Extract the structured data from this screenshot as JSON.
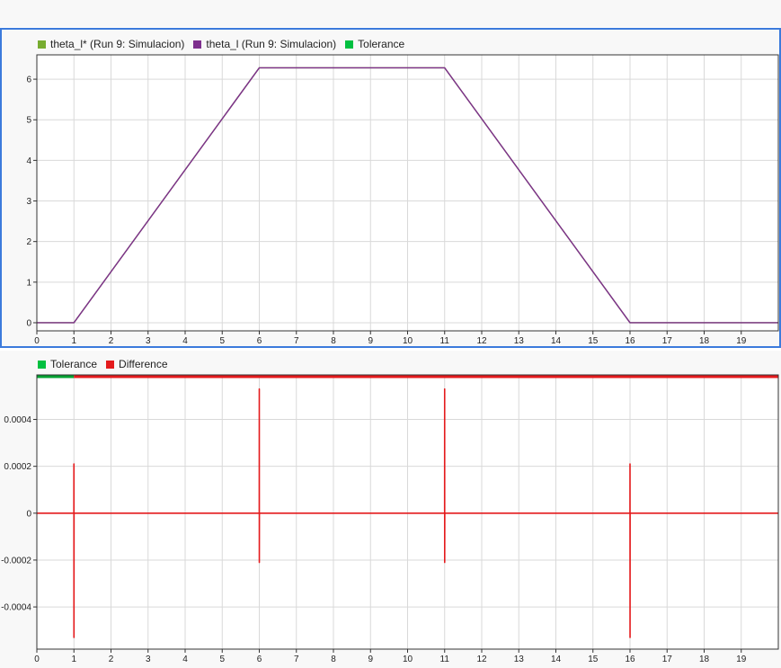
{
  "plots": [
    {
      "legend": [
        {
          "label": "theta_l* (Run 9: Simulacion)",
          "color": "#77ac30"
        },
        {
          "label": "theta_l (Run 9: Simulacion)",
          "color": "#7e2f8e"
        },
        {
          "label": "Tolerance",
          "color": "#00c040"
        }
      ]
    },
    {
      "legend": [
        {
          "label": "Tolerance",
          "color": "#00c040"
        },
        {
          "label": "Difference",
          "color": "#e41a1c"
        }
      ]
    }
  ],
  "chart_data": [
    {
      "type": "line",
      "xlim": [
        0,
        20
      ],
      "ylim": [
        -0.2,
        6.6
      ],
      "xticks": [
        "0",
        "1",
        "2",
        "3",
        "4",
        "5",
        "6",
        "7",
        "8",
        "9",
        "10",
        "11",
        "12",
        "13",
        "14",
        "15",
        "16",
        "17",
        "18",
        "19"
      ],
      "yticks": [
        "0",
        "1",
        "2",
        "3",
        "4",
        "5",
        "6"
      ],
      "grid": true,
      "legend_position": "top-left",
      "series": [
        {
          "name": "theta_l* (Run 9: Simulacion)",
          "color": "#77ac30",
          "x": [
            0,
            1,
            6,
            11,
            16,
            20
          ],
          "y": [
            0,
            0,
            6.28,
            6.28,
            0,
            0
          ]
        },
        {
          "name": "theta_l (Run 9: Simulacion)",
          "color": "#7e2f8e",
          "x": [
            0,
            1,
            6,
            11,
            16,
            20
          ],
          "y": [
            0,
            0,
            6.28,
            6.28,
            0,
            0
          ]
        }
      ]
    },
    {
      "type": "line",
      "xlim": [
        0,
        20
      ],
      "ylim": [
        -0.00058,
        0.00059
      ],
      "xticks": [
        "0",
        "1",
        "2",
        "3",
        "4",
        "5",
        "6",
        "7",
        "8",
        "9",
        "10",
        "11",
        "12",
        "13",
        "14",
        "15",
        "16",
        "17",
        "18",
        "19"
      ],
      "yticks": [
        {
          "value": -0.0004,
          "label": "-0.0004"
        },
        {
          "value": -0.0002,
          "label": "-0.0002"
        },
        {
          "value": 0,
          "label": "0"
        },
        {
          "value": 0.0002,
          "label": "0.0002"
        },
        {
          "value": 0.0004,
          "label": "0.0004"
        }
      ],
      "grid": true,
      "legend_position": "top-left",
      "tolerance": {
        "name": "Tolerance",
        "color": "#00a030",
        "x_end": 1
      },
      "series": [
        {
          "name": "Difference",
          "color": "#e41a1c",
          "x": [
            0,
            0.999,
            1,
            1.001,
            1.003,
            5.999,
            6,
            6.001,
            6.003,
            10.999,
            11,
            11.001,
            11.003,
            15.999,
            16,
            16.001,
            16.003,
            20
          ],
          "y": [
            0,
            0,
            0.00021,
            -0.00053,
            0,
            0,
            0.00053,
            -0.00021,
            0,
            0,
            0.00053,
            -0.00021,
            0,
            0,
            0.00021,
            -0.00053,
            0,
            0
          ]
        }
      ]
    }
  ]
}
